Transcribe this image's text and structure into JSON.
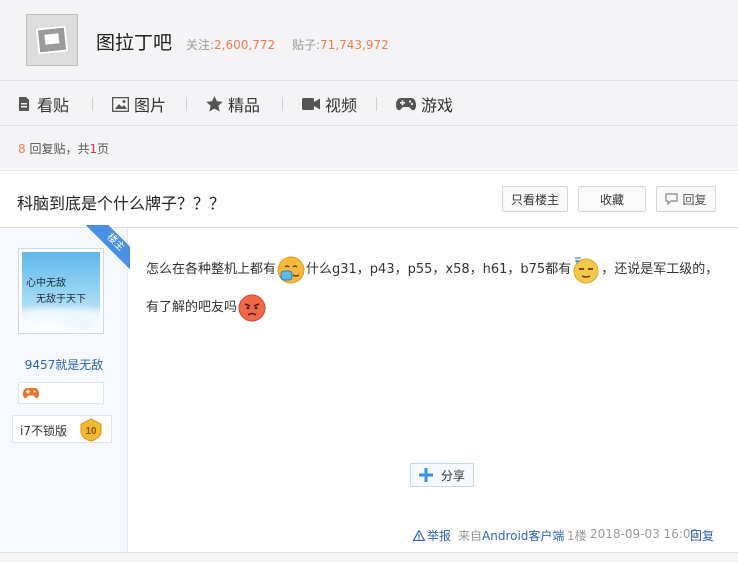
{
  "header": {
    "forum_name": "图拉丁吧",
    "follow_label": "关注:",
    "follow_count": "2,600,772",
    "posts_label": "贴子:",
    "posts_count": "71,743,972"
  },
  "nav": {
    "items": [
      {
        "label": "看贴",
        "icon": "document-icon"
      },
      {
        "label": "图片",
        "icon": "image-icon"
      },
      {
        "label": "精品",
        "icon": "star-icon"
      },
      {
        "label": "视频",
        "icon": "video-icon"
      },
      {
        "label": "游戏",
        "icon": "gamepad-icon"
      }
    ]
  },
  "reply_info": {
    "count": "8",
    "count_suffix": "回复贴，共",
    "pages": "1",
    "pages_suffix": "页"
  },
  "thread": {
    "title": "科脑到底是个什么牌子？？？",
    "only_op_label": "只看楼主",
    "favorite_label": "收藏",
    "reply_label": "回复"
  },
  "post": {
    "op_badge": "楼主",
    "avatar_text_1": "心中无敌",
    "avatar_text_2": "无敌于天下",
    "username": "9457就是无敌",
    "level_name": "i7不锁版",
    "level_number": "10",
    "content_part1": "怎么在各种整机上都有",
    "content_part2": "什么g31，p43，p55，x58，h61，b75都有",
    "content_part3": "，还说是军工级的，有了解的吧友吗",
    "share_label": "分享",
    "report_label": "举报",
    "from_prefix": "来自",
    "from_client": "Android客户端",
    "floor": "1楼",
    "timestamp": "2018-09-03 16:00",
    "reply_label": "回复"
  },
  "colors": {
    "accent_orange": "#f07c4a",
    "link_blue": "#2d64b3",
    "op_ribbon": "#4a90e2"
  }
}
